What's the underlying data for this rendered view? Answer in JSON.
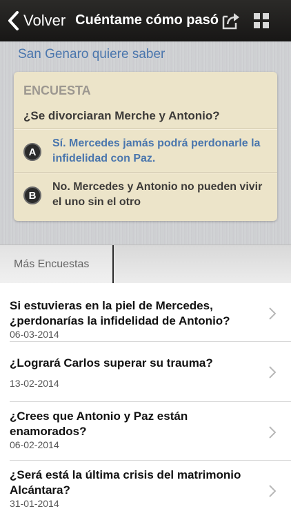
{
  "navbar": {
    "back_label": "Volver",
    "title": "Cuéntame cómo pasó",
    "share_icon": "share-icon",
    "grid_icon": "grid-icon"
  },
  "poll_section": {
    "title": "San Genaro quiere saber",
    "label": "ENCUESTA",
    "question": "¿Se divorciaran Merche y Antonio?",
    "options": [
      {
        "letter": "A",
        "text": "Sí. Mercedes jamás podrá perdonarle la infidelidad con Paz.",
        "color": "#4a76ad"
      },
      {
        "letter": "B",
        "text": "No. Mercedes y Antonio no pueden vivir el uno sin el otro",
        "color": "#3c3a38"
      }
    ]
  },
  "tabs": {
    "more_polls": "Más Encuestas"
  },
  "list": {
    "items": [
      {
        "title": "Si estuvieras en la piel de Mercedes, ¿perdonarías la infidelidad de Antonio?",
        "date": "06-03-2014"
      },
      {
        "title": "¿Logrará Carlos superar su trauma?",
        "date": "13-02-2014"
      },
      {
        "title": "¿Crees que Antonio y Paz están enamorados?",
        "date": "06-02-2014"
      },
      {
        "title": " ¿Será está la última crisis del matrimonio Alcántara?",
        "date": "31-01-2014"
      }
    ]
  }
}
